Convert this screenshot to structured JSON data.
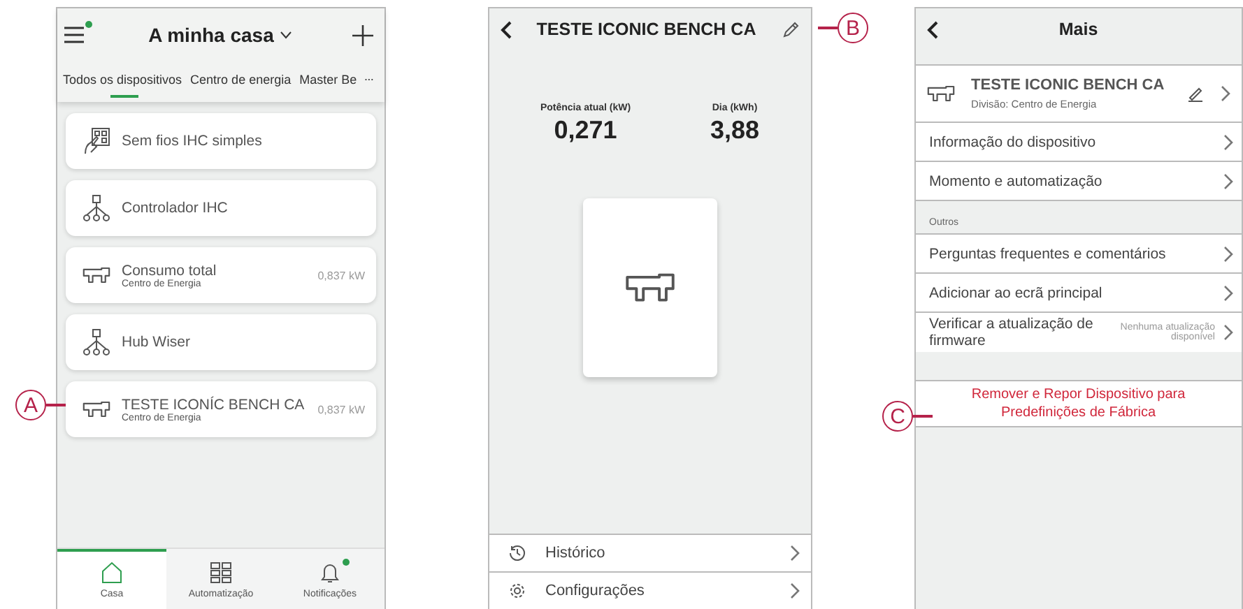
{
  "home": {
    "title": "A minha casa",
    "menu_badge": true,
    "tabs": [
      {
        "label": "Todos os dispositivos",
        "selected": true
      },
      {
        "label": "Centro de energia",
        "selected": false
      },
      {
        "label": "Master Be",
        "selected": false
      }
    ],
    "devices": [
      {
        "kind": "remote",
        "name": "Sem fios IHC simples"
      },
      {
        "kind": "hub",
        "name": "Controlador IHC"
      },
      {
        "kind": "meter",
        "name": "Consumo total",
        "room": "Centro de Energia",
        "reading": "0,837 kW"
      },
      {
        "kind": "hub",
        "name": "Hub Wiser"
      },
      {
        "kind": "meter",
        "name": "TESTE ICONÍC BENCH CA",
        "room": "Centro de Energia",
        "reading": "0,837 kW"
      }
    ],
    "nav": [
      {
        "kind": "home",
        "label": "Casa",
        "selected": true,
        "badge": false
      },
      {
        "kind": "grid",
        "label": "Automatização",
        "selected": false,
        "badge": false
      },
      {
        "kind": "bell",
        "label": "Notificações",
        "selected": false,
        "badge": true
      }
    ]
  },
  "detail": {
    "title": "TESTE ICONIC BENCH CA",
    "readings": [
      {
        "label": "Potência atual (kW)",
        "value": "0,271"
      },
      {
        "label": "Dia (kWh)",
        "value": "3,88"
      }
    ],
    "menu": [
      {
        "kind": "history",
        "label": "Histórico"
      },
      {
        "kind": "gear",
        "label": "Configurações"
      }
    ]
  },
  "more": {
    "title": "Mais",
    "device": {
      "name": "TESTE ICONIC BENCH CA",
      "division": "Divisão: Centro de Energia"
    },
    "groups": [
      {
        "items": [
          {
            "label": "Informação do dispositivo"
          },
          {
            "label": "Momento e automatização"
          }
        ]
      },
      {
        "heading": "Outros",
        "items": [
          {
            "label": "Perguntas frequentes e comentários"
          },
          {
            "label": "Adicionar ao ecrã principal"
          },
          {
            "label": "Verificar a atualização de firmware",
            "status": "Nenhuma atualização disponível"
          }
        ]
      }
    ],
    "danger_action": "Remover e Repor Dispositivo para Predefinições de Fábrica"
  },
  "callouts": [
    {
      "label": "A"
    },
    {
      "label": "B"
    },
    {
      "label": "C"
    }
  ]
}
